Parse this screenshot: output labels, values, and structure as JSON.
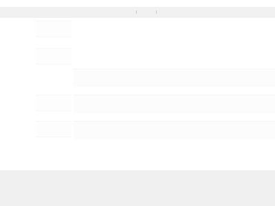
{
  "toolbar": {
    "title": ""
  },
  "sidebar": {
    "items": [
      {
        "label": ""
      },
      {
        "label": ""
      },
      {
        "label": ""
      },
      {
        "label": ""
      }
    ]
  },
  "main": {
    "bands": [
      {
        "text": ""
      },
      {
        "text": ""
      },
      {
        "text": ""
      }
    ]
  },
  "footer": {
    "text": ""
  },
  "colors": {
    "background": "#ffffff",
    "toolbar": "#f1f1f1",
    "footer": "#f0f0f0"
  }
}
